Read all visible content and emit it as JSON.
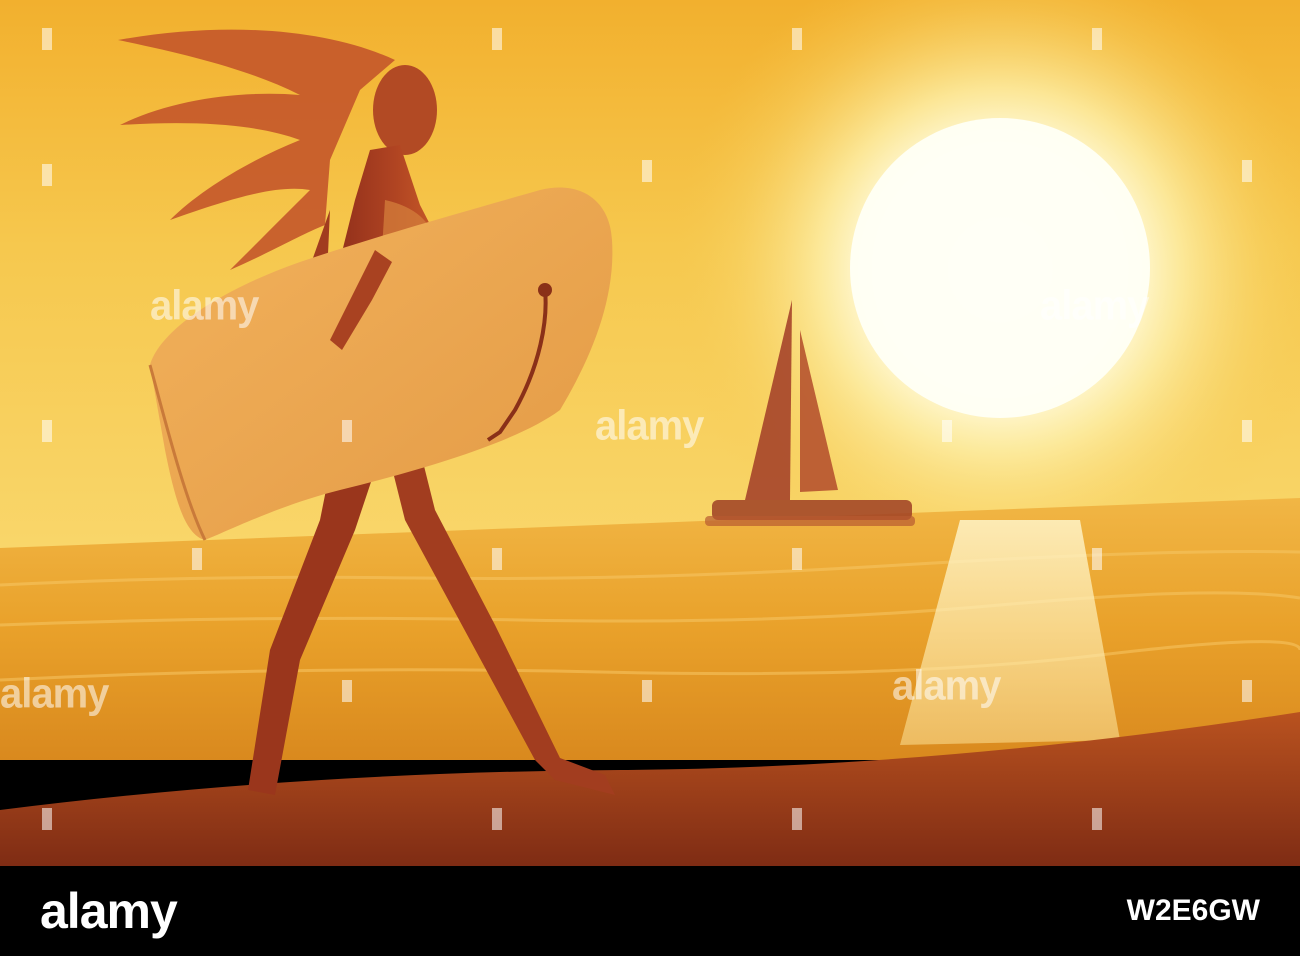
{
  "watermark": {
    "text": "alamy"
  },
  "footer": {
    "logo_text": "alamy",
    "image_id": "W2E6GW"
  },
  "colors": {
    "sky_top": "#f3b531",
    "sky_mid": "#f7d160",
    "sun_core": "#fffef4",
    "sea": "#e8a023",
    "sand": "#a4411c",
    "silhouette": "#a0381f",
    "footer_bg": "#000000"
  }
}
